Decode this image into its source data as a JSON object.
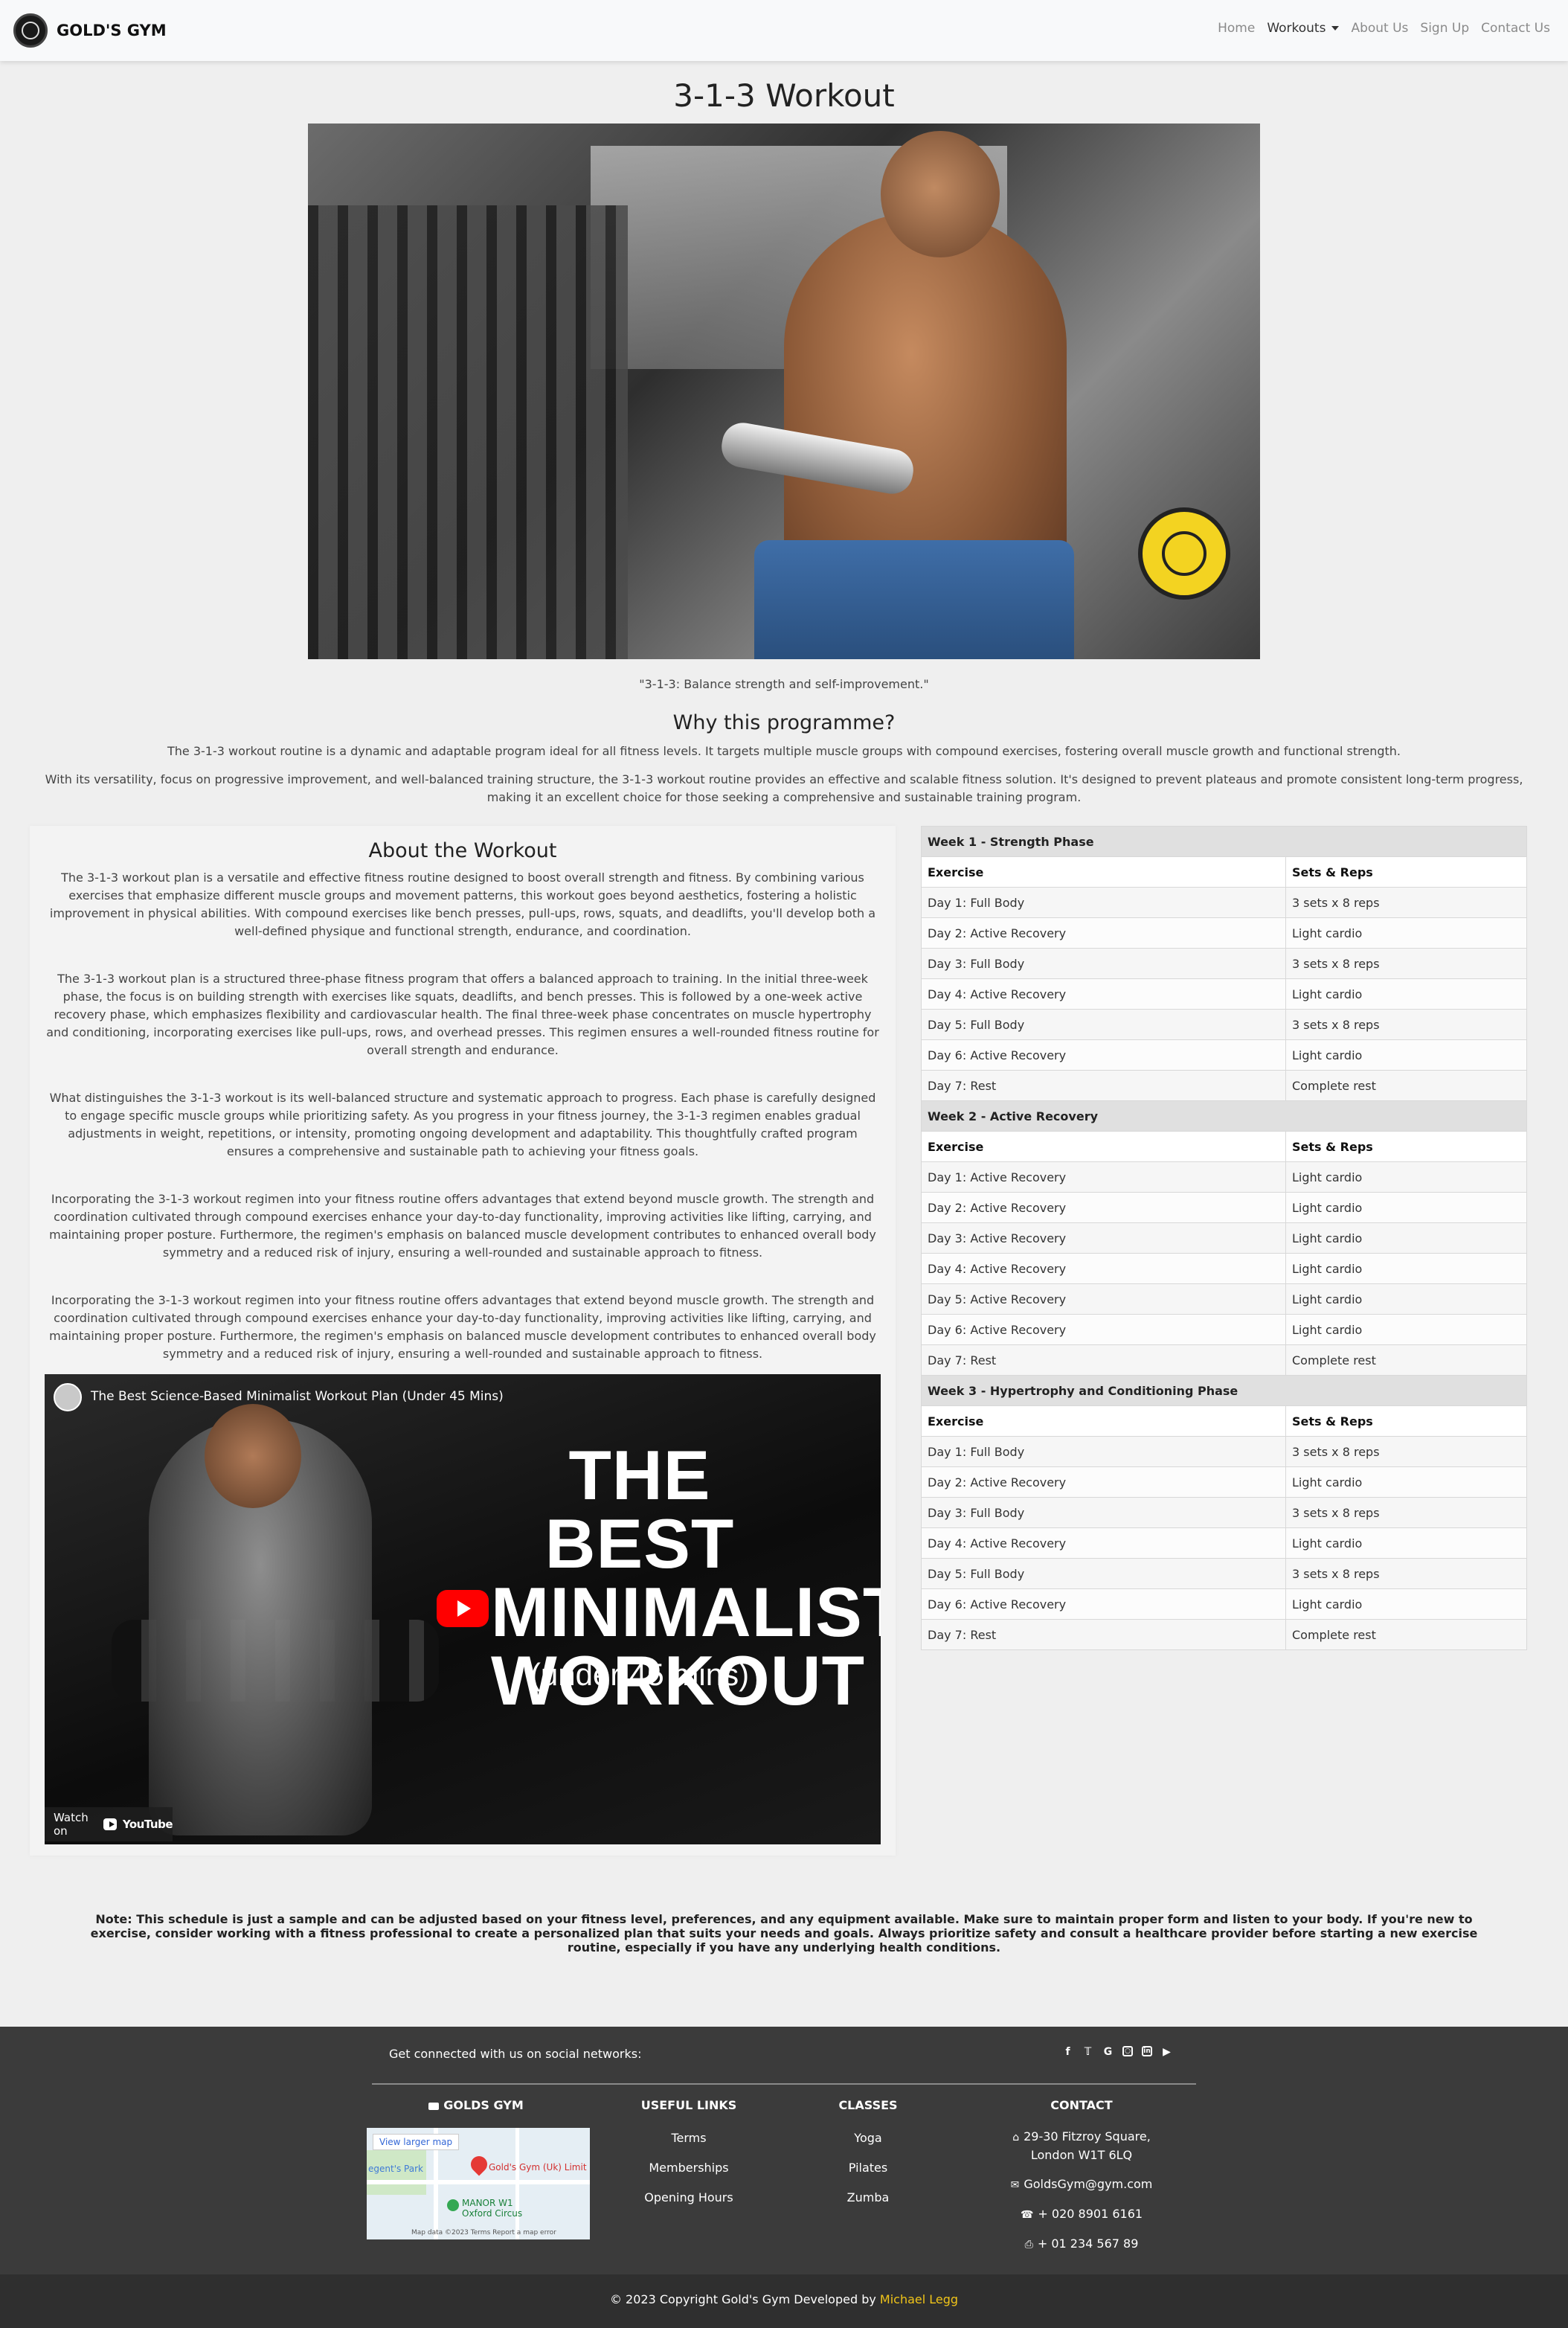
{
  "nav": {
    "brand": "GOLD'S GYM",
    "links": [
      {
        "label": "Home"
      },
      {
        "label": "Workouts"
      },
      {
        "label": "About Us"
      },
      {
        "label": "Sign Up"
      },
      {
        "label": "Contact Us"
      }
    ]
  },
  "page": {
    "title": "3-1-3 Workout",
    "quote": "\"3-1-3: Balance strength and self-improvement.\""
  },
  "why": {
    "title": "Why this programme?",
    "p1": "The 3-1-3 workout routine is a dynamic and adaptable program ideal for all fitness levels. It targets multiple muscle groups with compound exercises, fostering overall muscle growth and functional strength.",
    "p2": "With its versatility, focus on progressive improvement, and well-balanced training structure, the 3-1-3 workout routine provides an effective and scalable fitness solution. It's designed to prevent plateaus and promote consistent long-term progress, making it an excellent choice for those seeking a comprehensive and sustainable training program."
  },
  "about": {
    "title": "About the Workout",
    "paragraphs": [
      "The 3-1-3 workout plan is a versatile and effective fitness routine designed to boost overall strength and fitness. By combining various exercises that emphasize different muscle groups and movement patterns, this workout goes beyond aesthetics, fostering a holistic improvement in physical abilities. With compound exercises like bench presses, pull-ups, rows, squats, and deadlifts, you'll develop both a well-defined physique and functional strength, endurance, and coordination.",
      "The 3-1-3 workout plan is a structured three-phase fitness program that offers a balanced approach to training. In the initial three-week phase, the focus is on building strength with exercises like squats, deadlifts, and bench presses. This is followed by a one-week active recovery phase, which emphasizes flexibility and cardiovascular health. The final three-week phase concentrates on muscle hypertrophy and conditioning, incorporating exercises like pull-ups, rows, and overhead presses. This regimen ensures a well-rounded fitness routine for overall strength and endurance.",
      "What distinguishes the 3-1-3 workout is its well-balanced structure and systematic approach to progress. Each phase is carefully designed to engage specific muscle groups while prioritizing safety. As you progress in your fitness journey, the 3-1-3 regimen enables gradual adjustments in weight, repetitions, or intensity, promoting ongoing development and adaptability. This thoughtfully crafted program ensures a comprehensive and sustainable path to achieving your fitness goals.",
      "Incorporating the 3-1-3 workout regimen into your fitness routine offers advantages that extend beyond muscle growth. The strength and coordination cultivated through compound exercises enhance your day-to-day functionality, improving activities like lifting, carrying, and maintaining proper posture. Furthermore, the regimen's emphasis on balanced muscle development contributes to enhanced overall body symmetry and a reduced risk of injury, ensuring a well-rounded and sustainable approach to fitness.",
      "Incorporating the 3-1-3 workout regimen into your fitness routine offers advantages that extend beyond muscle growth. The strength and coordination cultivated through compound exercises enhance your day-to-day functionality, improving activities like lifting, carrying, and maintaining proper posture. Furthermore, the regimen's emphasis on balanced muscle development contributes to enhanced overall body symmetry and a reduced risk of injury, ensuring a well-rounded and sustainable approach to fitness."
    ]
  },
  "video": {
    "title": "The Best Science-Based Minimalist Workout Plan (Under 45 Mins)",
    "thumb_line1": "THE BEST",
    "thumb_line2": "MINIMALIST",
    "thumb_line3": "WORKOUT",
    "thumb_sub": "(under 45 mins)",
    "watch_on": "Watch on",
    "youtube": "YouTube"
  },
  "schedule": {
    "col_exercise": "Exercise",
    "col_sets": "Sets & Reps",
    "weeks": [
      {
        "title": "Week 1 - Strength Phase",
        "rows": [
          [
            "Day 1: Full Body",
            "3 sets x 8 reps"
          ],
          [
            "Day 2: Active Recovery",
            "Light cardio"
          ],
          [
            "Day 3: Full Body",
            "3 sets x 8 reps"
          ],
          [
            "Day 4: Active Recovery",
            "Light cardio"
          ],
          [
            "Day 5: Full Body",
            "3 sets x 8 reps"
          ],
          [
            "Day 6: Active Recovery",
            "Light cardio"
          ],
          [
            "Day 7: Rest",
            "Complete rest"
          ]
        ]
      },
      {
        "title": "Week 2 - Active Recovery",
        "rows": [
          [
            "Day 1: Active Recovery",
            "Light cardio"
          ],
          [
            "Day 2: Active Recovery",
            "Light cardio"
          ],
          [
            "Day 3: Active Recovery",
            "Light cardio"
          ],
          [
            "Day 4: Active Recovery",
            "Light cardio"
          ],
          [
            "Day 5: Active Recovery",
            "Light cardio"
          ],
          [
            "Day 6: Active Recovery",
            "Light cardio"
          ],
          [
            "Day 7: Rest",
            "Complete rest"
          ]
        ]
      },
      {
        "title": "Week 3 - Hypertrophy and Conditioning Phase",
        "rows": [
          [
            "Day 1: Full Body",
            "3 sets x 8 reps"
          ],
          [
            "Day 2: Active Recovery",
            "Light cardio"
          ],
          [
            "Day 3: Full Body",
            "3 sets x 8 reps"
          ],
          [
            "Day 4: Active Recovery",
            "Light cardio"
          ],
          [
            "Day 5: Full Body",
            "3 sets x 8 reps"
          ],
          [
            "Day 6: Active Recovery",
            "Light cardio"
          ],
          [
            "Day 7: Rest",
            "Complete rest"
          ]
        ]
      }
    ]
  },
  "note": "Note: This schedule is just a sample and can be adjusted based on your fitness level, preferences, and any equipment available. Make sure to maintain proper form and listen to your body. If you're new to exercise, consider working with a fitness professional to create a personalized plan that suits your needs and goals. Always prioritize safety and consult a healthcare provider before starting a new exercise routine, especially if you have any underlying health conditions.",
  "footer": {
    "social_text": "Get connected with us on social networks:",
    "social_icons": [
      "facebook-icon",
      "twitter-icon",
      "google-icon",
      "instagram-icon",
      "linkedin-icon",
      "youtube-icon"
    ],
    "brand_heading": "GOLDS GYM",
    "map": {
      "view_larger": "View larger map",
      "place": "Gold's Gym (Uk) Limit",
      "park": "egent's Park",
      "station": "MANOR W1",
      "station2": "Oxford Circus",
      "attribution": "Map data ©2023   Terms   Report a map error"
    },
    "links_heading": "USEFUL LINKS",
    "links": [
      "Terms",
      "Memberships",
      "Opening Hours"
    ],
    "classes_heading": "CLASSES",
    "classes": [
      "Yoga",
      "Pilates",
      "Zumba"
    ],
    "contact_heading": "CONTACT",
    "address_line1": "29-30 Fitzroy Square,",
    "address_line2": "London W1T 6LQ",
    "email": "GoldsGym@gym.com",
    "phone": "+ 020 8901 6161",
    "fax": "+ 01 234 567 89",
    "copyright": "© 2023 Copyright Gold's Gym Developed by ",
    "author": "Michael Legg"
  },
  "colors": {
    "accent_gold": "#f0c419",
    "footer_bg": "#3b3b3b",
    "youtube_red": "#ff0000"
  }
}
